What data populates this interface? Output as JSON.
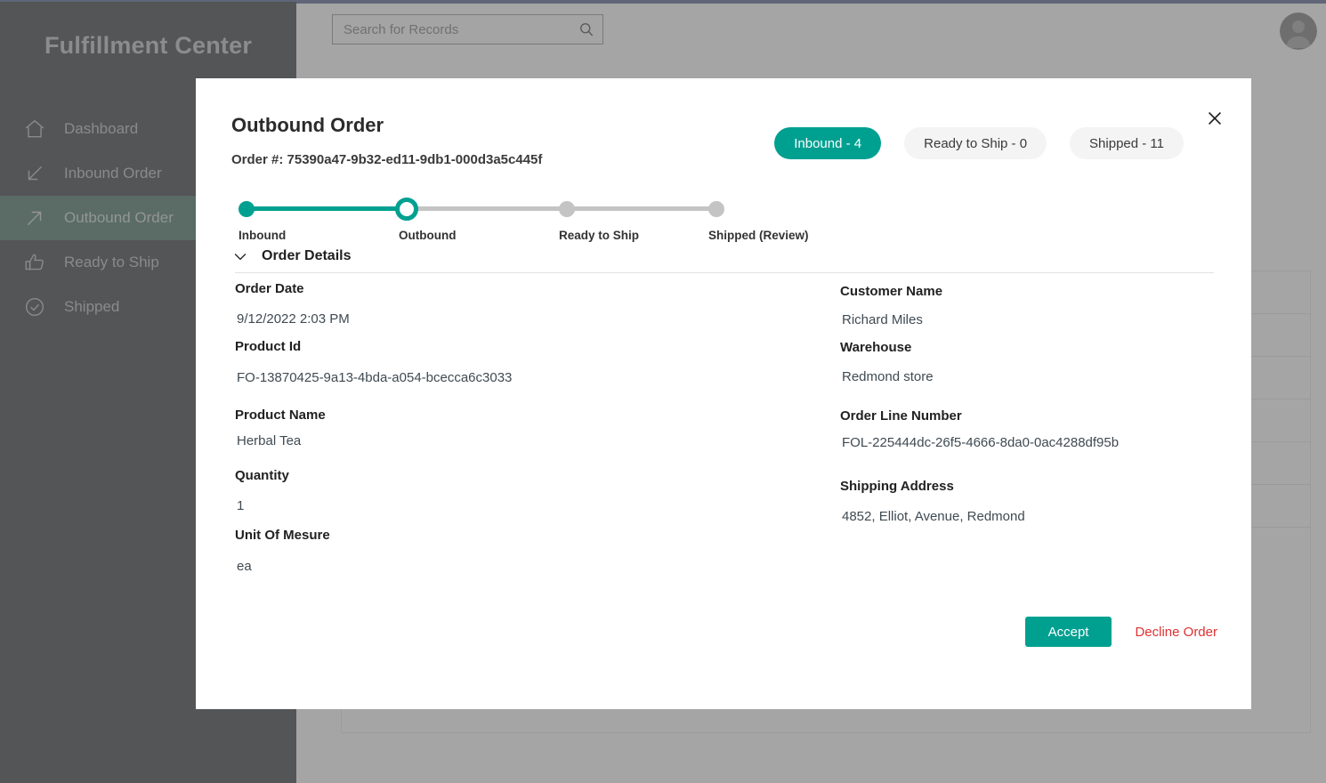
{
  "app": {
    "brand": "Fulfillment Center",
    "accent_color": "#00a091",
    "sidebar_bg": "#292d30",
    "sidebar_active_bg": "#3a6b57",
    "decline_color": "#e03030"
  },
  "search": {
    "placeholder": "Search for Records",
    "value": "",
    "icon": "search-icon"
  },
  "header": {
    "avatar_icon": "user-avatar-icon"
  },
  "sidebar": {
    "items": [
      {
        "label": "Dashboard",
        "icon": "home-icon",
        "active": false
      },
      {
        "label": "Inbound Order",
        "icon": "arrow-down-left-icon",
        "active": false
      },
      {
        "label": "Outbound Order",
        "icon": "arrow-up-right-icon",
        "active": true
      },
      {
        "label": "Ready to Ship",
        "icon": "thumbs-up-icon",
        "active": false
      },
      {
        "label": "Shipped",
        "icon": "check-circle-icon",
        "active": false
      }
    ]
  },
  "modal": {
    "title": "Outbound Order",
    "order_number_label": "Order #: 75390a47-9b32-ed11-9db1-000d3a5c445f",
    "close_icon": "close-icon",
    "pills": [
      {
        "label": "Inbound - 4",
        "active": true
      },
      {
        "label": "Ready to Ship - 0",
        "active": false
      },
      {
        "label": "Shipped - 11",
        "active": false
      }
    ],
    "stepper": {
      "steps": [
        {
          "label": "Inbound",
          "state": "done"
        },
        {
          "label": "Outbound",
          "state": "current"
        },
        {
          "label": "Ready to Ship",
          "state": "pending"
        },
        {
          "label": "Shipped (Review)",
          "state": "pending"
        }
      ]
    },
    "section": {
      "title": "Order Details",
      "chevron_icon": "chevron-down-icon",
      "left_fields": [
        {
          "label": "Order Date",
          "value": "9/12/2022 2:03 PM"
        },
        {
          "label": "Product Id",
          "value": "FO-13870425-9a13-4bda-a054-bcecca6c3033"
        },
        {
          "label": "Product Name",
          "value": "Herbal Tea"
        },
        {
          "label": "Quantity",
          "value": "1"
        },
        {
          "label": "Unit Of Mesure",
          "value": "ea"
        }
      ],
      "right_fields": [
        {
          "label": "Customer Name",
          "value": "Richard Miles"
        },
        {
          "label": "Warehouse",
          "value": "Redmond store"
        },
        {
          "label": "Order Line Number",
          "value": "FOL-225444dc-26f5-4666-8da0-0ac4288df95b"
        },
        {
          "label": "Shipping Address",
          "value": "4852, Elliot, Avenue, Redmond"
        }
      ]
    },
    "actions": {
      "accept_label": "Accept",
      "decline_label": "Decline Order"
    }
  }
}
